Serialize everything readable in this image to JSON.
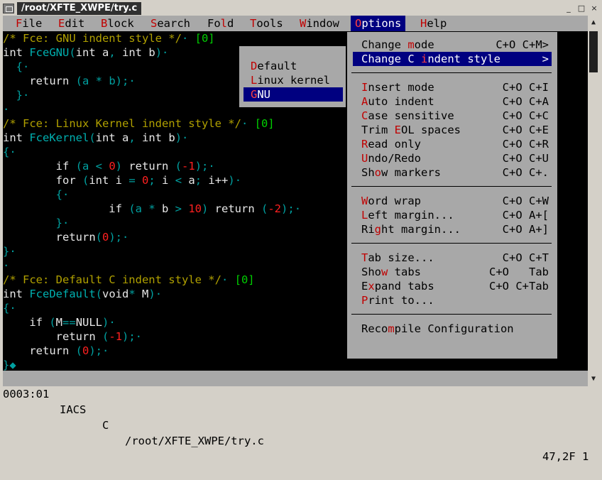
{
  "window": {
    "title": "/root/XFTE_XWPE/try.c",
    "minimize_glyph": "_",
    "maximize_glyph": "□",
    "close_glyph": "×"
  },
  "menubar": [
    {
      "hot": "F",
      "rest": "ile"
    },
    {
      "hot": "E",
      "rest": "dit"
    },
    {
      "hot": "B",
      "rest": "lock"
    },
    {
      "hot": "S",
      "rest": "earch"
    },
    {
      "pre": "Fo",
      "hot": "l",
      "rest": "d"
    },
    {
      "hot": "T",
      "rest": "ools"
    },
    {
      "hot": "W",
      "rest": "indow"
    },
    {
      "hot": "O",
      "rest": "ptions"
    },
    {
      "hot": "H",
      "rest": "elp"
    }
  ],
  "editor_lines": [
    [
      {
        "t": "/* Fce: GNU indent style */",
        "c": "c-comment"
      },
      {
        "t": "· ",
        "c": "c-dot"
      },
      {
        "t": "[0]",
        "c": "c-tag"
      }
    ],
    [
      {
        "t": "int ",
        "c": "c-kw"
      },
      {
        "t": "FceGNU",
        "c": "c-fn"
      },
      {
        "t": "(",
        "c": "c-punct"
      },
      {
        "t": "int a",
        "c": "c-kw"
      },
      {
        "t": ", ",
        "c": "c-punct"
      },
      {
        "t": "int b",
        "c": "c-kw"
      },
      {
        "t": ")",
        "c": "c-punct"
      },
      {
        "t": "·",
        "c": "c-dot"
      }
    ],
    [
      {
        "t": "  {",
        "c": "c-punct"
      },
      {
        "t": "·",
        "c": "c-dot"
      }
    ],
    [
      {
        "t": "    return ",
        "c": "c-kw"
      },
      {
        "t": "(a ",
        "c": "c-punct"
      },
      {
        "t": "* ",
        "c": "c-punct"
      },
      {
        "t": "b)",
        "c": "c-punct"
      },
      {
        "t": ";",
        "c": "c-punct"
      },
      {
        "t": "·",
        "c": "c-dot"
      }
    ],
    [
      {
        "t": "  }",
        "c": "c-punct"
      },
      {
        "t": "·",
        "c": "c-dot"
      }
    ],
    [
      {
        "t": "·",
        "c": "c-dot"
      }
    ],
    [
      {
        "t": "/* Fce: Linux Kernel indent style */",
        "c": "c-comment"
      },
      {
        "t": "· ",
        "c": "c-dot"
      },
      {
        "t": "[0]",
        "c": "c-tag"
      }
    ],
    [
      {
        "t": "int ",
        "c": "c-kw"
      },
      {
        "t": "FceKernel",
        "c": "c-fn"
      },
      {
        "t": "(",
        "c": "c-punct"
      },
      {
        "t": "int a",
        "c": "c-kw"
      },
      {
        "t": ", ",
        "c": "c-punct"
      },
      {
        "t": "int b",
        "c": "c-kw"
      },
      {
        "t": ")",
        "c": "c-punct"
      },
      {
        "t": "·",
        "c": "c-dot"
      }
    ],
    [
      {
        "t": "{",
        "c": "c-punct"
      },
      {
        "t": "·",
        "c": "c-dot"
      }
    ],
    [
      {
        "t": "        if ",
        "c": "c-kw"
      },
      {
        "t": "(a ",
        "c": "c-punct"
      },
      {
        "t": "< ",
        "c": "c-punct"
      },
      {
        "t": "0",
        "c": "c-num"
      },
      {
        "t": ") ",
        "c": "c-punct"
      },
      {
        "t": "return ",
        "c": "c-kw"
      },
      {
        "t": "(",
        "c": "c-punct"
      },
      {
        "t": "-1",
        "c": "c-num"
      },
      {
        "t": ");",
        "c": "c-punct"
      },
      {
        "t": "·",
        "c": "c-dot"
      }
    ],
    [
      {
        "t": "        for ",
        "c": "c-kw"
      },
      {
        "t": "(",
        "c": "c-punct"
      },
      {
        "t": "int i ",
        "c": "c-kw"
      },
      {
        "t": "= ",
        "c": "c-punct"
      },
      {
        "t": "0",
        "c": "c-num"
      },
      {
        "t": "; ",
        "c": "c-punct"
      },
      {
        "t": "i ",
        "c": "c-kw"
      },
      {
        "t": "< ",
        "c": "c-punct"
      },
      {
        "t": "a",
        "c": "c-kw"
      },
      {
        "t": "; ",
        "c": "c-punct"
      },
      {
        "t": "i++",
        "c": "c-kw"
      },
      {
        "t": ")",
        "c": "c-punct"
      },
      {
        "t": "·",
        "c": "c-dot"
      }
    ],
    [
      {
        "t": "        {",
        "c": "c-punct"
      },
      {
        "t": "·",
        "c": "c-dot"
      }
    ],
    [
      {
        "t": "                if ",
        "c": "c-kw"
      },
      {
        "t": "(a ",
        "c": "c-punct"
      },
      {
        "t": "* ",
        "c": "c-punct"
      },
      {
        "t": "b ",
        "c": "c-kw"
      },
      {
        "t": "> ",
        "c": "c-punct"
      },
      {
        "t": "10",
        "c": "c-num"
      },
      {
        "t": ") ",
        "c": "c-punct"
      },
      {
        "t": "return ",
        "c": "c-kw"
      },
      {
        "t": "(",
        "c": "c-punct"
      },
      {
        "t": "-2",
        "c": "c-num"
      },
      {
        "t": ");",
        "c": "c-punct"
      },
      {
        "t": "·",
        "c": "c-dot"
      }
    ],
    [
      {
        "t": "        }",
        "c": "c-punct"
      },
      {
        "t": "·",
        "c": "c-dot"
      }
    ],
    [
      {
        "t": "        return",
        "c": "c-kw"
      },
      {
        "t": "(",
        "c": "c-punct"
      },
      {
        "t": "0",
        "c": "c-num"
      },
      {
        "t": ");",
        "c": "c-punct"
      },
      {
        "t": "·",
        "c": "c-dot"
      }
    ],
    [
      {
        "t": "}",
        "c": "c-punct"
      },
      {
        "t": "·",
        "c": "c-dot"
      }
    ],
    [
      {
        "t": "·",
        "c": "c-dot"
      }
    ],
    [
      {
        "t": "/* Fce: Default C indent style */",
        "c": "c-comment"
      },
      {
        "t": "· ",
        "c": "c-dot"
      },
      {
        "t": "[0]",
        "c": "c-tag"
      }
    ],
    [
      {
        "t": "int ",
        "c": "c-kw"
      },
      {
        "t": "FceDefault",
        "c": "c-fn"
      },
      {
        "t": "(",
        "c": "c-punct"
      },
      {
        "t": "void",
        "c": "c-kw"
      },
      {
        "t": "* ",
        "c": "c-punct"
      },
      {
        "t": "M",
        "c": "c-kw"
      },
      {
        "t": ")",
        "c": "c-punct"
      },
      {
        "t": "·",
        "c": "c-dot"
      }
    ],
    [
      {
        "t": "{",
        "c": "c-punct"
      },
      {
        "t": "·",
        "c": "c-dot"
      }
    ],
    [
      {
        "t": "    if ",
        "c": "c-kw"
      },
      {
        "t": "(",
        "c": "c-punct"
      },
      {
        "t": "M",
        "c": "c-kw"
      },
      {
        "t": "==",
        "c": "c-punct"
      },
      {
        "t": "NULL",
        "c": "c-kw"
      },
      {
        "t": ")",
        "c": "c-punct"
      },
      {
        "t": "·",
        "c": "c-dot"
      }
    ],
    [
      {
        "t": "        return ",
        "c": "c-kw"
      },
      {
        "t": "(",
        "c": "c-punct"
      },
      {
        "t": "-1",
        "c": "c-num"
      },
      {
        "t": ");",
        "c": "c-punct"
      },
      {
        "t": "·",
        "c": "c-dot"
      }
    ],
    [
      {
        "t": "    return ",
        "c": "c-kw"
      },
      {
        "t": "(",
        "c": "c-punct"
      },
      {
        "t": "0",
        "c": "c-num"
      },
      {
        "t": ");",
        "c": "c-punct"
      },
      {
        "t": "·",
        "c": "c-dot"
      }
    ],
    [
      {
        "t": "}",
        "c": "c-punct"
      },
      {
        "t": "◆",
        "c": "c-punct"
      }
    ]
  ],
  "options_menu": {
    "groups": [
      [
        {
          "pre": "Change ",
          "hot": "m",
          "rest": "ode",
          "key": "C+O C+M>"
        },
        {
          "pre": "Change C ",
          "hot": "i",
          "rest": "ndent style",
          "key": ">",
          "selected": true
        }
      ],
      [
        {
          "pre": "",
          "hot": "I",
          "rest": "nsert mode",
          "key": "C+O C+I"
        },
        {
          "pre": "",
          "hot": "A",
          "rest": "uto indent",
          "key": "C+O C+A"
        },
        {
          "pre": "",
          "hot": "C",
          "rest": "ase sensitive",
          "key": "C+O C+C"
        },
        {
          "pre": "Trim ",
          "hot": "E",
          "rest": "OL spaces",
          "key": "C+O C+E"
        },
        {
          "pre": "",
          "hot": "R",
          "rest": "ead only",
          "key": "C+O C+R"
        },
        {
          "pre": "",
          "hot": "U",
          "rest": "ndo/Redo",
          "key": "C+O C+U"
        },
        {
          "pre": "Sh",
          "hot": "o",
          "rest": "w markers",
          "key": "C+O C+."
        }
      ],
      [
        {
          "pre": "",
          "hot": "W",
          "rest": "ord wrap",
          "key": "C+O C+W"
        },
        {
          "pre": "",
          "hot": "L",
          "rest": "eft margin...",
          "key": "C+O A+["
        },
        {
          "pre": "Ri",
          "hot": "g",
          "rest": "ht margin...",
          "key": "C+O A+]"
        }
      ],
      [
        {
          "pre": "",
          "hot": "T",
          "rest": "ab size...",
          "key": "C+O C+T"
        },
        {
          "pre": "Sho",
          "hot": "w",
          "rest": " tabs",
          "key": "C+O   Tab"
        },
        {
          "pre": "E",
          "hot": "x",
          "rest": "pand tabs",
          "key": "C+O C+Tab"
        },
        {
          "pre": "",
          "hot": "P",
          "rest": "rint to...",
          "key": ""
        }
      ],
      [
        {
          "pre": "Reco",
          "hot": "m",
          "rest": "pile Configuration",
          "key": ""
        }
      ]
    ]
  },
  "indent_submenu": [
    {
      "pre": "",
      "hot": "D",
      "rest": "efault"
    },
    {
      "pre": "",
      "hot": "L",
      "rest": "inux kernel"
    },
    {
      "pre": "",
      "hot": "G",
      "rest": "NU",
      "selected": true
    }
  ],
  "status": {
    "position": "0003:01",
    "mode": "IACS",
    "lang": "C",
    "path": "/root/XFTE_XWPE/try.c",
    "right": "47,2F 1"
  },
  "scrollbar": {
    "up": "▲",
    "down": "▼"
  }
}
